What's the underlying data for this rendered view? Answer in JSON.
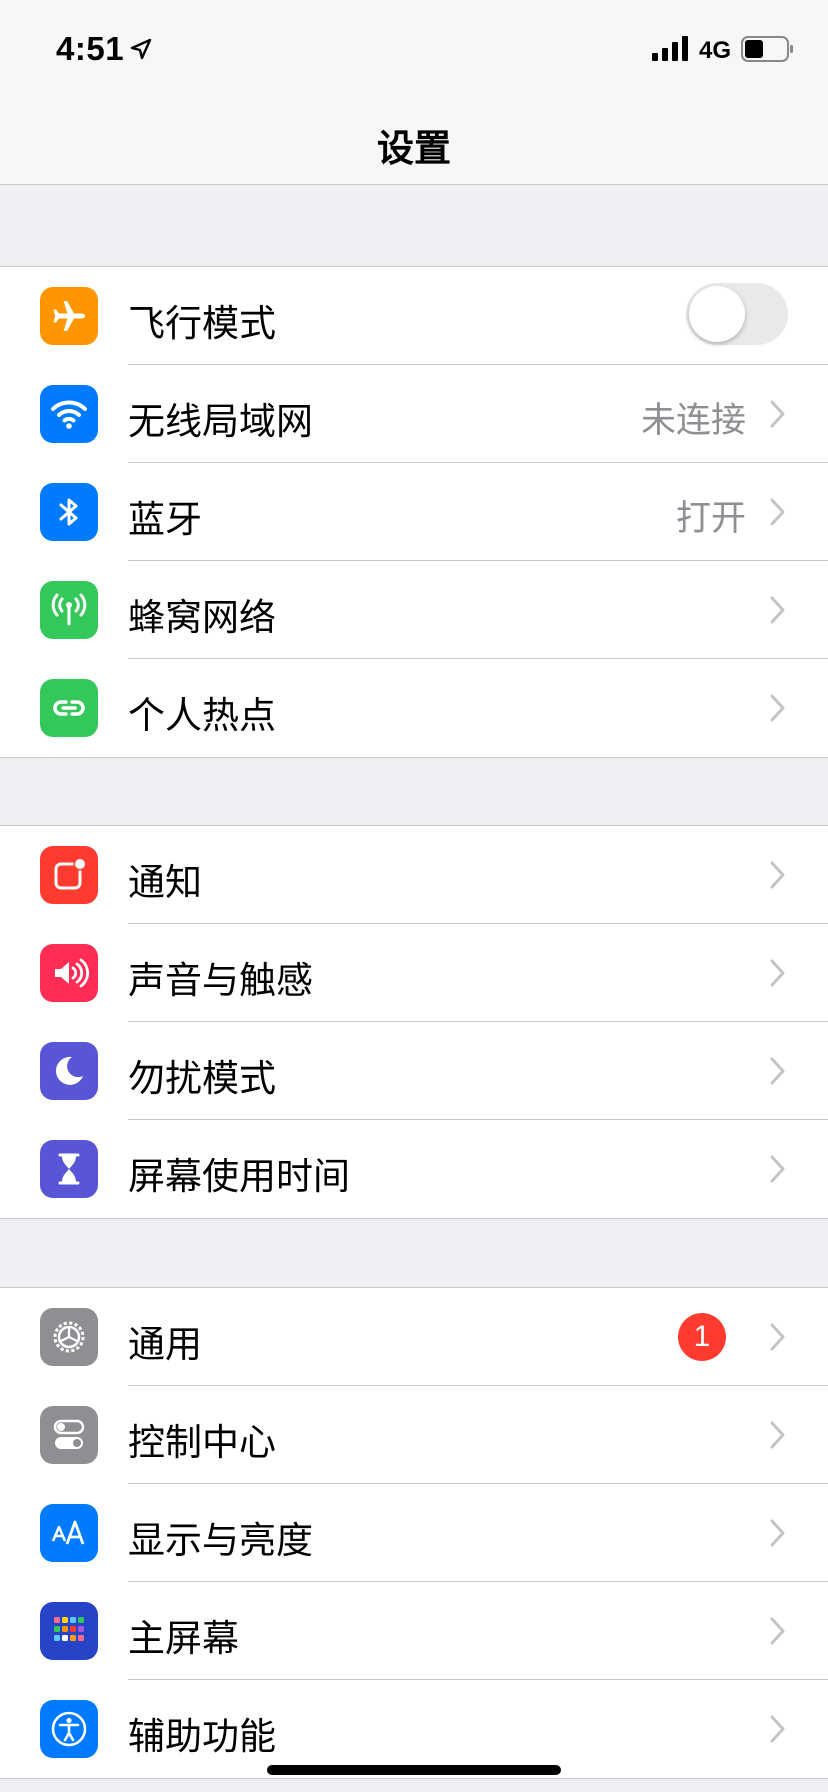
{
  "status_bar": {
    "time": "4:51",
    "network": "4G"
  },
  "nav": {
    "title": "设置"
  },
  "groups": [
    {
      "items": [
        {
          "label": "飞行模式",
          "icon": "airplane-icon",
          "icon_color": "#ff9500",
          "control": "toggle",
          "toggle_on": false
        },
        {
          "label": "无线局域网",
          "icon": "wifi-icon",
          "icon_color": "#007aff",
          "value": "未连接"
        },
        {
          "label": "蓝牙",
          "icon": "bluetooth-icon",
          "icon_color": "#007aff",
          "value": "打开"
        },
        {
          "label": "蜂窝网络",
          "icon": "cellular-icon",
          "icon_color": "#34c759"
        },
        {
          "label": "个人热点",
          "icon": "hotspot-icon",
          "icon_color": "#34c759"
        }
      ]
    },
    {
      "items": [
        {
          "label": "通知",
          "icon": "notification-icon",
          "icon_color": "#ff3b30"
        },
        {
          "label": "声音与触感",
          "icon": "speaker-icon",
          "icon_color": "#ff2d55"
        },
        {
          "label": "勿扰模式",
          "icon": "moon-icon",
          "icon_color": "#5856d6"
        },
        {
          "label": "屏幕使用时间",
          "icon": "hourglass-icon",
          "icon_color": "#5856d6"
        }
      ]
    },
    {
      "items": [
        {
          "label": "通用",
          "icon": "gear-icon",
          "icon_color": "#8e8e93",
          "badge": "1"
        },
        {
          "label": "控制中心",
          "icon": "switches-icon",
          "icon_color": "#8e8e93"
        },
        {
          "label": "显示与亮度",
          "icon": "text-size-icon",
          "icon_color": "#007aff"
        },
        {
          "label": "主屏幕",
          "icon": "home-grid-icon",
          "icon_color": "#2743c8"
        },
        {
          "label": "辅助功能",
          "icon": "accessibility-icon",
          "icon_color": "#007aff"
        }
      ]
    }
  ]
}
